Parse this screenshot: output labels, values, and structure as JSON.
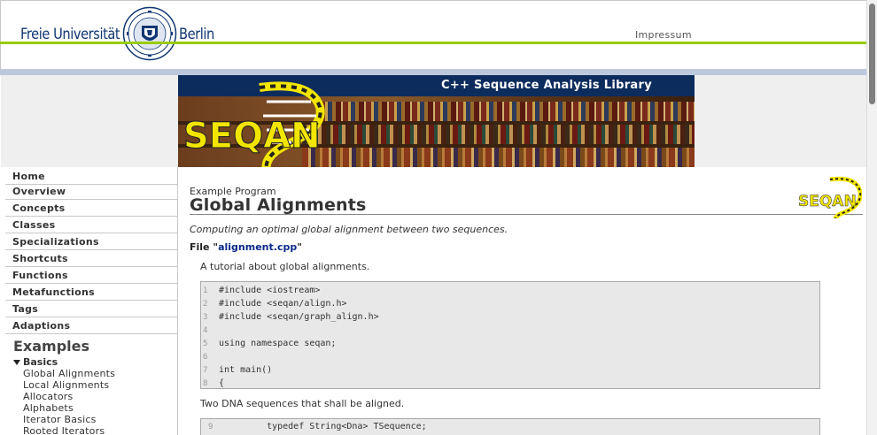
{
  "header": {
    "uni_left": "Freie Universität",
    "uni_right": "Berlin",
    "impressum": "Impressum"
  },
  "banner": {
    "title": "C++ Sequence Analysis Library",
    "logo_text": "SEQAN"
  },
  "sidebar": {
    "items": [
      {
        "label": "Home"
      },
      {
        "label": "Overview"
      },
      {
        "label": "Concepts"
      },
      {
        "label": "Classes"
      },
      {
        "label": "Specializations"
      },
      {
        "label": "Shortcuts"
      },
      {
        "label": "Functions"
      },
      {
        "label": "Metafunctions"
      },
      {
        "label": "Tags"
      },
      {
        "label": "Adaptions"
      }
    ],
    "examples_heading": "Examples",
    "group_label": "Basics",
    "sub_items": [
      {
        "label": "Global Alignments"
      },
      {
        "label": "Local Alignments"
      },
      {
        "label": "Allocators"
      },
      {
        "label": "Alphabets"
      },
      {
        "label": "Iterator Basics"
      },
      {
        "label": "Rooted Iterators"
      }
    ]
  },
  "main": {
    "kicker": "Example Program",
    "title": "Global Alignments",
    "description": "Computing an optimal global alignment between two sequences.",
    "file_prefix": "File \"",
    "file_link": "alignment.cpp",
    "file_suffix": "\"",
    "tutorial_text": "A tutorial about global alignments.",
    "code_lines": [
      {
        "n": "1",
        "text": "#include <iostream>"
      },
      {
        "n": "2",
        "text": "#include <seqan/align.h>"
      },
      {
        "n": "3",
        "text": "#include <seqan/graph_align.h>"
      },
      {
        "n": "4",
        "text": ""
      },
      {
        "n": "5",
        "text": "using namespace seqan;"
      },
      {
        "n": "6",
        "text": ""
      },
      {
        "n": "7",
        "text": "int main()"
      },
      {
        "n": "8",
        "text": "{"
      }
    ],
    "dna_text": "Two DNA sequences that shall be aligned.",
    "code2_lines": [
      {
        "n": "9",
        "text": "    typedef String<Dna> TSequence;"
      }
    ]
  },
  "colors": {
    "accent_green": "#99cc00",
    "fu_blue": "#0f3672",
    "banner_navy": "#0d2c5e",
    "link": "#0a2a88"
  }
}
